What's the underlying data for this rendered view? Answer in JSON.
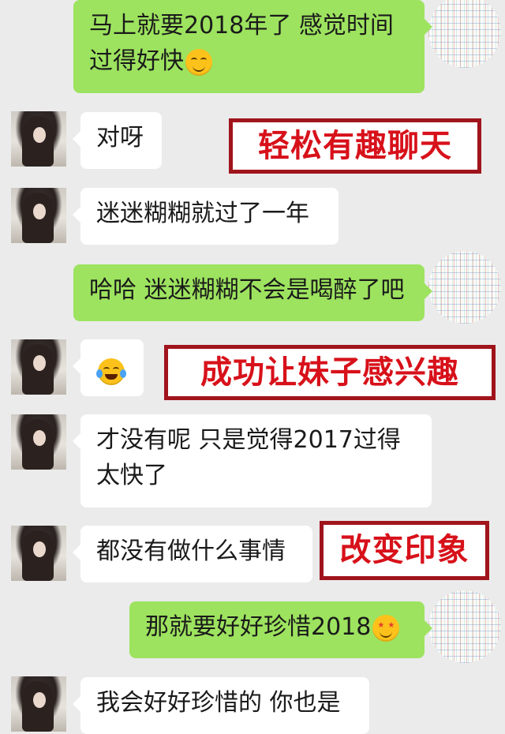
{
  "messages": [
    {
      "side": "right",
      "text": "马上就要2018年了 感觉时间过得好快",
      "emoji": "smiling-emoji"
    },
    {
      "side": "left",
      "text": "对呀"
    },
    {
      "side": "left",
      "text": "迷迷糊糊就过了一年"
    },
    {
      "side": "right",
      "text": "哈哈 迷迷糊糊不会是喝醉了吧"
    },
    {
      "side": "left",
      "text": "",
      "emoji": "tears-of-joy-emoji"
    },
    {
      "side": "left",
      "text": "才没有呢  只是觉得2017过得太快了"
    },
    {
      "side": "left",
      "text": "都没有做什么事情"
    },
    {
      "side": "right",
      "text": "那就要好好珍惜2018",
      "emoji": "star-eyes-emoji"
    },
    {
      "side": "left",
      "text": "我会好好珍惜的 你也是"
    }
  ],
  "annotations": [
    {
      "text": "轻松有趣聊天"
    },
    {
      "text": "成功让妹子感兴趣"
    },
    {
      "text": "改变印象"
    }
  ],
  "colors": {
    "background": "#ebebeb",
    "bubble_self": "#9de35f",
    "bubble_other": "#ffffff",
    "label_text": "#d7111a",
    "label_border": "#a0141b"
  }
}
